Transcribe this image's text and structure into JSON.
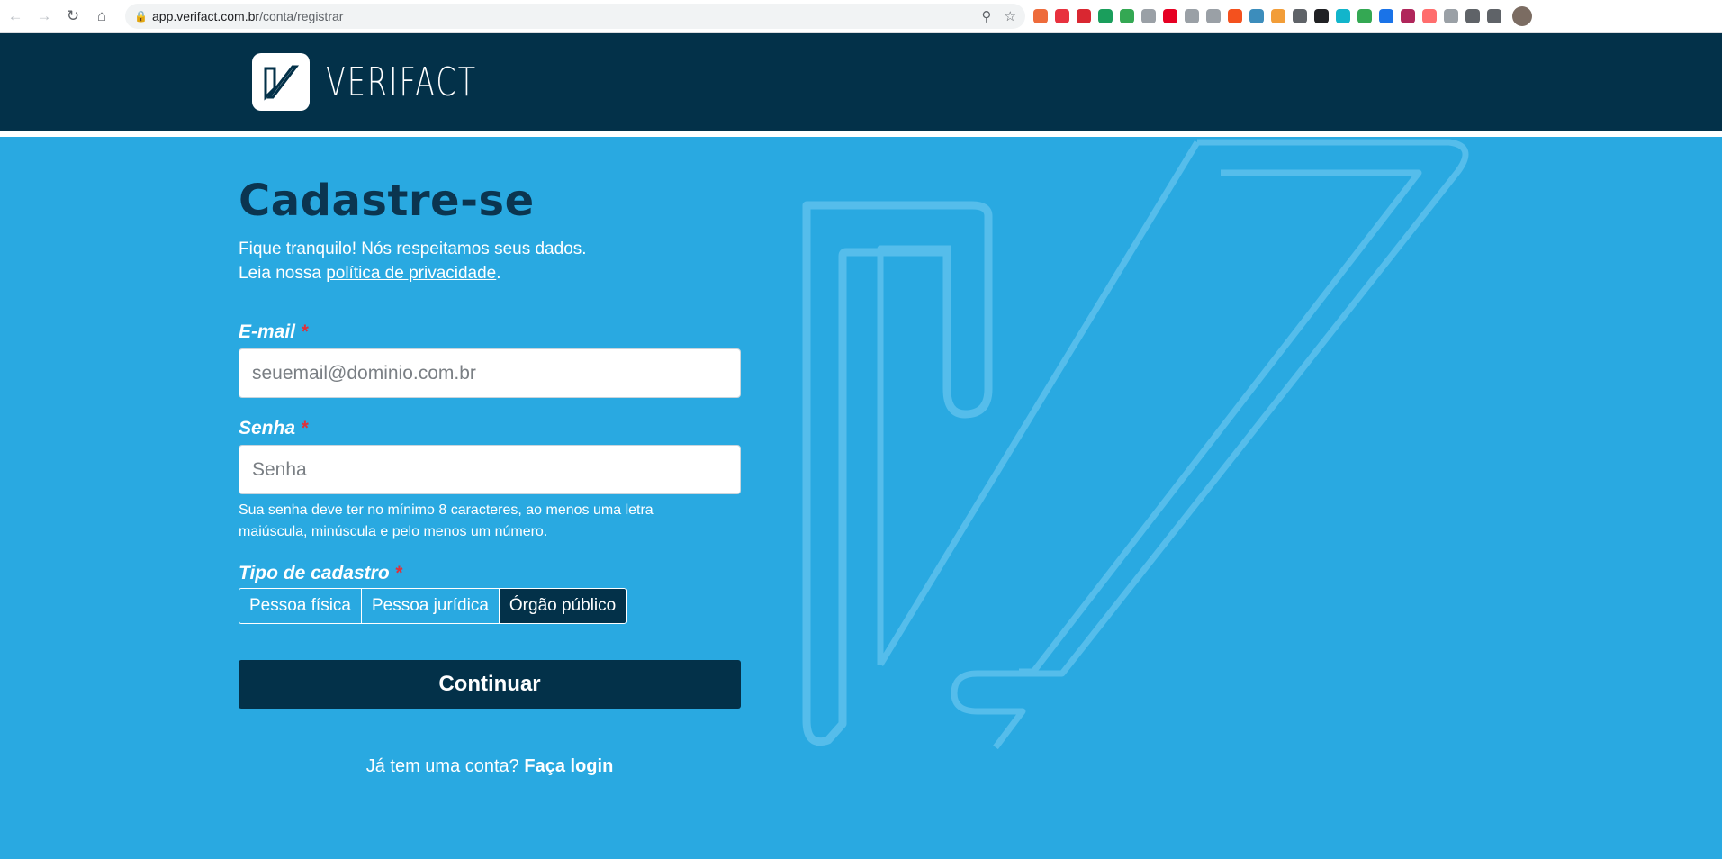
{
  "browser": {
    "url_host": "app.verifact.com.br",
    "url_path": "/conta/registrar",
    "extension_colors": [
      "#ee6b3b",
      "#e8313e",
      "#d92731",
      "#1a9e5c",
      "#34a853",
      "#9aa0a6",
      "#e60023",
      "#9aa0a6",
      "#9aa0a6",
      "#f4511e",
      "#3c8dbc",
      "#f29d38",
      "#5f6368",
      "#202124",
      "#12b5cb",
      "#34a853",
      "#1a73e8",
      "#b0265b",
      "#ff6d6d",
      "#9aa0a6",
      "#5f6368",
      "#5f6368"
    ]
  },
  "header": {
    "brand": "VERIFACT"
  },
  "form": {
    "title": "Cadastre-se",
    "subtitle_line1": "Fique tranquilo! Nós respeitamos seus dados.",
    "subtitle_line2_prefix": "Leia nossa ",
    "privacy_link": "política de privacidade",
    "subtitle_line2_suffix": ".",
    "email_label": "E-mail",
    "email_placeholder": "seuemail@dominio.com.br",
    "password_label": "Senha",
    "password_placeholder": "Senha",
    "password_hint": "Sua senha deve ter no mínimo 8 caracteres, ao menos uma letra maiúscula, minúscula e pelo menos um número.",
    "required_mark": "*",
    "type_label": "Tipo de cadastro",
    "type_options": [
      "Pessoa física",
      "Pessoa jurídica",
      "Órgão público"
    ],
    "type_selected": "Órgão público",
    "submit_label": "Continuar",
    "login_prompt": "Já tem uma conta?",
    "login_link": "Faça login"
  },
  "colors": {
    "background": "#29a9e1",
    "header": "#033149",
    "title": "#0b3550",
    "required": "#e0303a"
  }
}
